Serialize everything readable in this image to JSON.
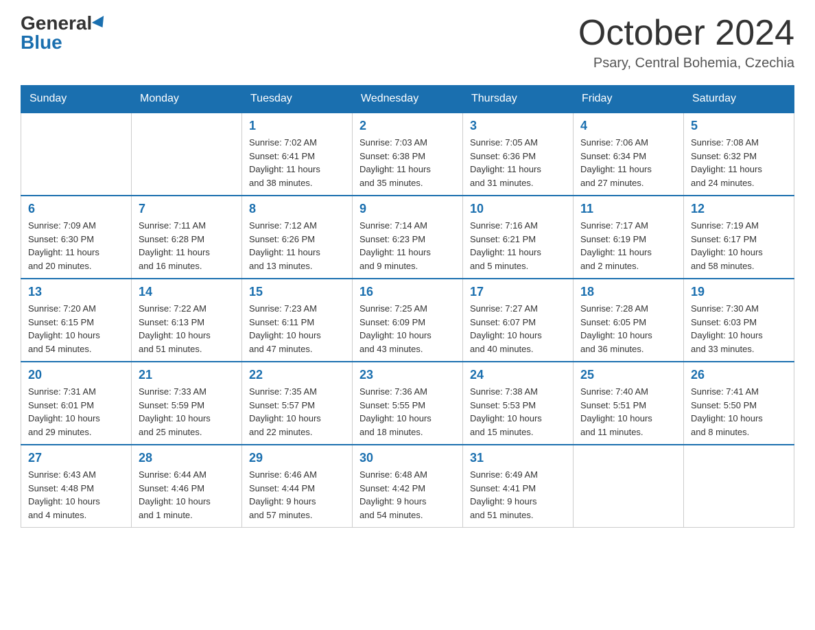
{
  "header": {
    "logo_general": "General",
    "logo_blue": "Blue",
    "month_title": "October 2024",
    "location": "Psary, Central Bohemia, Czechia"
  },
  "weekdays": [
    "Sunday",
    "Monday",
    "Tuesday",
    "Wednesday",
    "Thursday",
    "Friday",
    "Saturday"
  ],
  "weeks": [
    [
      {
        "day": "",
        "info": ""
      },
      {
        "day": "",
        "info": ""
      },
      {
        "day": "1",
        "info": "Sunrise: 7:02 AM\nSunset: 6:41 PM\nDaylight: 11 hours\nand 38 minutes."
      },
      {
        "day": "2",
        "info": "Sunrise: 7:03 AM\nSunset: 6:38 PM\nDaylight: 11 hours\nand 35 minutes."
      },
      {
        "day": "3",
        "info": "Sunrise: 7:05 AM\nSunset: 6:36 PM\nDaylight: 11 hours\nand 31 minutes."
      },
      {
        "day": "4",
        "info": "Sunrise: 7:06 AM\nSunset: 6:34 PM\nDaylight: 11 hours\nand 27 minutes."
      },
      {
        "day": "5",
        "info": "Sunrise: 7:08 AM\nSunset: 6:32 PM\nDaylight: 11 hours\nand 24 minutes."
      }
    ],
    [
      {
        "day": "6",
        "info": "Sunrise: 7:09 AM\nSunset: 6:30 PM\nDaylight: 11 hours\nand 20 minutes."
      },
      {
        "day": "7",
        "info": "Sunrise: 7:11 AM\nSunset: 6:28 PM\nDaylight: 11 hours\nand 16 minutes."
      },
      {
        "day": "8",
        "info": "Sunrise: 7:12 AM\nSunset: 6:26 PM\nDaylight: 11 hours\nand 13 minutes."
      },
      {
        "day": "9",
        "info": "Sunrise: 7:14 AM\nSunset: 6:23 PM\nDaylight: 11 hours\nand 9 minutes."
      },
      {
        "day": "10",
        "info": "Sunrise: 7:16 AM\nSunset: 6:21 PM\nDaylight: 11 hours\nand 5 minutes."
      },
      {
        "day": "11",
        "info": "Sunrise: 7:17 AM\nSunset: 6:19 PM\nDaylight: 11 hours\nand 2 minutes."
      },
      {
        "day": "12",
        "info": "Sunrise: 7:19 AM\nSunset: 6:17 PM\nDaylight: 10 hours\nand 58 minutes."
      }
    ],
    [
      {
        "day": "13",
        "info": "Sunrise: 7:20 AM\nSunset: 6:15 PM\nDaylight: 10 hours\nand 54 minutes."
      },
      {
        "day": "14",
        "info": "Sunrise: 7:22 AM\nSunset: 6:13 PM\nDaylight: 10 hours\nand 51 minutes."
      },
      {
        "day": "15",
        "info": "Sunrise: 7:23 AM\nSunset: 6:11 PM\nDaylight: 10 hours\nand 47 minutes."
      },
      {
        "day": "16",
        "info": "Sunrise: 7:25 AM\nSunset: 6:09 PM\nDaylight: 10 hours\nand 43 minutes."
      },
      {
        "day": "17",
        "info": "Sunrise: 7:27 AM\nSunset: 6:07 PM\nDaylight: 10 hours\nand 40 minutes."
      },
      {
        "day": "18",
        "info": "Sunrise: 7:28 AM\nSunset: 6:05 PM\nDaylight: 10 hours\nand 36 minutes."
      },
      {
        "day": "19",
        "info": "Sunrise: 7:30 AM\nSunset: 6:03 PM\nDaylight: 10 hours\nand 33 minutes."
      }
    ],
    [
      {
        "day": "20",
        "info": "Sunrise: 7:31 AM\nSunset: 6:01 PM\nDaylight: 10 hours\nand 29 minutes."
      },
      {
        "day": "21",
        "info": "Sunrise: 7:33 AM\nSunset: 5:59 PM\nDaylight: 10 hours\nand 25 minutes."
      },
      {
        "day": "22",
        "info": "Sunrise: 7:35 AM\nSunset: 5:57 PM\nDaylight: 10 hours\nand 22 minutes."
      },
      {
        "day": "23",
        "info": "Sunrise: 7:36 AM\nSunset: 5:55 PM\nDaylight: 10 hours\nand 18 minutes."
      },
      {
        "day": "24",
        "info": "Sunrise: 7:38 AM\nSunset: 5:53 PM\nDaylight: 10 hours\nand 15 minutes."
      },
      {
        "day": "25",
        "info": "Sunrise: 7:40 AM\nSunset: 5:51 PM\nDaylight: 10 hours\nand 11 minutes."
      },
      {
        "day": "26",
        "info": "Sunrise: 7:41 AM\nSunset: 5:50 PM\nDaylight: 10 hours\nand 8 minutes."
      }
    ],
    [
      {
        "day": "27",
        "info": "Sunrise: 6:43 AM\nSunset: 4:48 PM\nDaylight: 10 hours\nand 4 minutes."
      },
      {
        "day": "28",
        "info": "Sunrise: 6:44 AM\nSunset: 4:46 PM\nDaylight: 10 hours\nand 1 minute."
      },
      {
        "day": "29",
        "info": "Sunrise: 6:46 AM\nSunset: 4:44 PM\nDaylight: 9 hours\nand 57 minutes."
      },
      {
        "day": "30",
        "info": "Sunrise: 6:48 AM\nSunset: 4:42 PM\nDaylight: 9 hours\nand 54 minutes."
      },
      {
        "day": "31",
        "info": "Sunrise: 6:49 AM\nSunset: 4:41 PM\nDaylight: 9 hours\nand 51 minutes."
      },
      {
        "day": "",
        "info": ""
      },
      {
        "day": "",
        "info": ""
      }
    ]
  ]
}
